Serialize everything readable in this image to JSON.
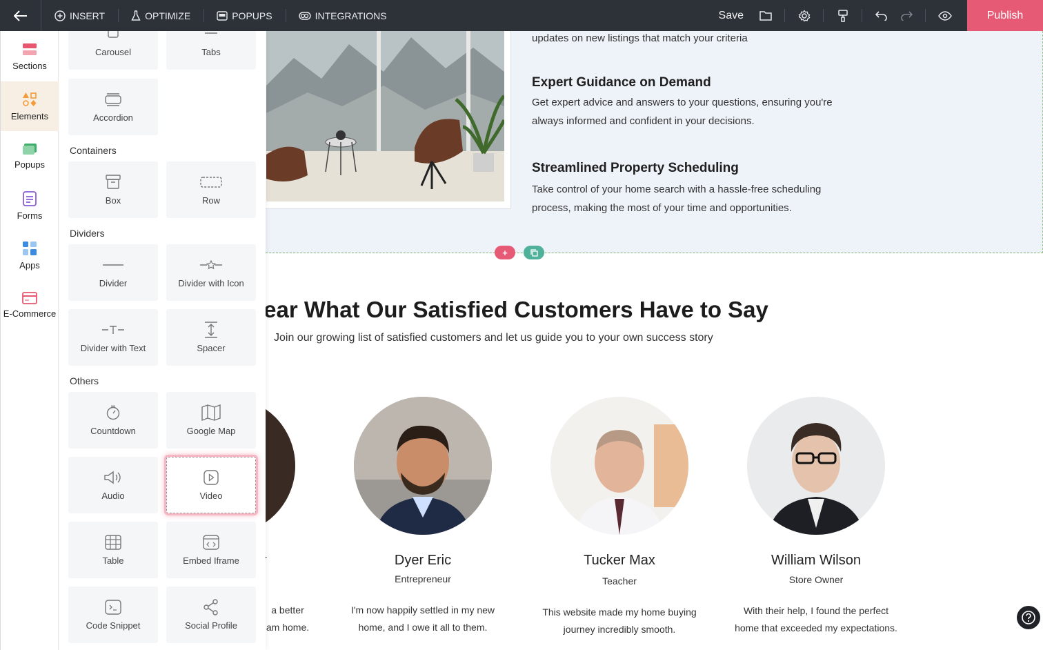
{
  "topbar": {
    "nav": [
      {
        "label": "INSERT",
        "icon": "plus-circle-icon"
      },
      {
        "label": "OPTIMIZE",
        "icon": "flask-icon"
      },
      {
        "label": "POPUPS",
        "icon": "popup-window-icon"
      },
      {
        "label": "INTEGRATIONS",
        "icon": "toggle-link-icon"
      }
    ],
    "save_label": "Save",
    "publish_label": "Publish"
  },
  "rail": {
    "items": [
      {
        "label": "Sections",
        "icon": "sections-icon",
        "color": "#e9566f"
      },
      {
        "label": "Elements",
        "icon": "shapes-icon",
        "color": "#f29a3c"
      },
      {
        "label": "Popups",
        "icon": "popups-icon",
        "color": "#3fae6b"
      },
      {
        "label": "Forms",
        "icon": "form-icon",
        "color": "#8a5cd6"
      },
      {
        "label": "Apps",
        "icon": "apps-grid-icon",
        "color": "#3b8be0"
      },
      {
        "label": "E-Commerce",
        "icon": "card-icon",
        "color": "#e9566f"
      }
    ]
  },
  "panel": {
    "tiles_top": [
      {
        "label": "Carousel"
      },
      {
        "label": "Tabs"
      },
      {
        "label": "Accordion"
      }
    ],
    "containers_title": "Containers",
    "containers": [
      {
        "label": "Box"
      },
      {
        "label": "Row"
      }
    ],
    "dividers_title": "Dividers",
    "dividers": [
      {
        "label": "Divider"
      },
      {
        "label": "Divider with Icon"
      },
      {
        "label": "Divider with Text"
      },
      {
        "label": "Spacer"
      }
    ],
    "others_title": "Others",
    "others": [
      {
        "label": "Countdown"
      },
      {
        "label": "Google Map"
      },
      {
        "label": "Audio"
      },
      {
        "label": "Video"
      },
      {
        "label": "Table"
      },
      {
        "label": "Embed Iframe"
      },
      {
        "label": "Code Snippet"
      },
      {
        "label": "Social Profile"
      }
    ]
  },
  "features": {
    "top_text": "updates on new listings that match your criteria",
    "items": [
      {
        "title": "Expert Guidance on Demand",
        "text1": "Get expert advice and answers to your questions, ensuring you're",
        "text2": "always informed and confident in your decisions."
      },
      {
        "title": "Streamlined Property Scheduling",
        "text1": "Take control of your home search with a hassle-free scheduling",
        "text2": "process, making the most of your time and opportunities."
      }
    ]
  },
  "section_controls": {
    "add": "+",
    "copy": "copy-icon"
  },
  "testimonials": {
    "title": "lear What Our Satisfied Customers Have to Say",
    "subtitle": "Join our growing list of satisfied customers and let us guide you to your own success story",
    "partial": {
      "name": "tor",
      "quote1": "a better",
      "quote2": "am home."
    },
    "people": [
      {
        "name": "Dyer Eric",
        "role": "Entrepreneur",
        "quote1": "I'm now happily settled in my new",
        "quote2": "home, and I owe it all to them."
      },
      {
        "name": "Tucker Max",
        "role": "Teacher",
        "quote1": "This website made my home buying",
        "quote2": "journey incredibly smooth."
      },
      {
        "name": "William Wilson",
        "role": "Store Owner",
        "quote1": "With their help, I found the perfect",
        "quote2": "home that exceeded my expectations."
      }
    ]
  },
  "colors": {
    "topbar": "#2d3138",
    "publish": "#e75a76",
    "section_bg": "#eef2f9",
    "add_pill": "#e75a76",
    "copy_pill": "#4fb19a"
  }
}
